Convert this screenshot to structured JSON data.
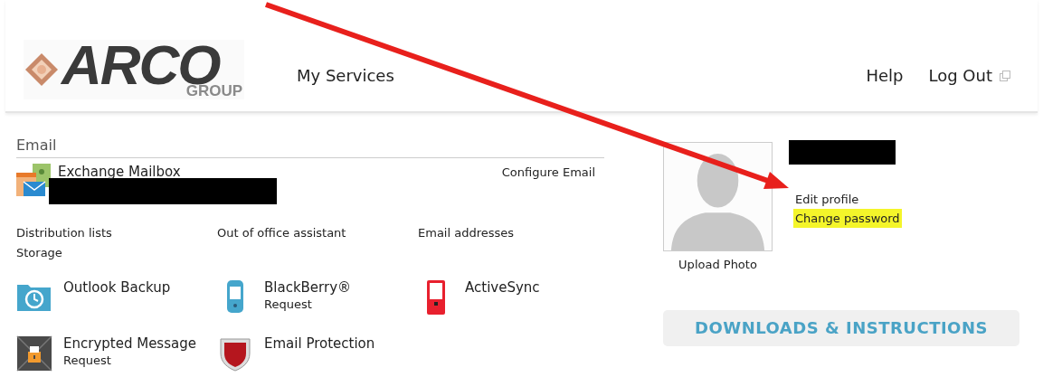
{
  "header": {
    "logo": {
      "main": "ARCO",
      "sub": "GROUP"
    },
    "nav": [
      {
        "label": "My Services"
      }
    ],
    "right_links": [
      {
        "label": "Help",
        "external": false
      },
      {
        "label": "Log Out",
        "external": true
      }
    ]
  },
  "email": {
    "title": "Email",
    "mailbox": {
      "name": "Exchange Mailbox",
      "action": "Configure Email"
    },
    "links": [
      "Distribution lists",
      "Out of office assistant",
      "Email addresses",
      "Storage"
    ],
    "services": [
      {
        "name": "Outlook Backup",
        "kind": "backup"
      },
      {
        "name": "BlackBerry®",
        "sub": "Request",
        "kind": "phone"
      },
      {
        "name": "ActiveSync",
        "kind": "sync"
      },
      {
        "name": "Encrypted Message",
        "sub": "Request",
        "kind": "lock"
      },
      {
        "name": "Email Protection",
        "kind": "shield"
      }
    ]
  },
  "profile": {
    "photo_caption": "Upload Photo",
    "links": [
      {
        "label": "Edit profile",
        "highlighted": false
      },
      {
        "label": "Change password",
        "highlighted": true
      }
    ],
    "downloads_button": "DOWNLOADS & INSTRUCTIONS"
  }
}
